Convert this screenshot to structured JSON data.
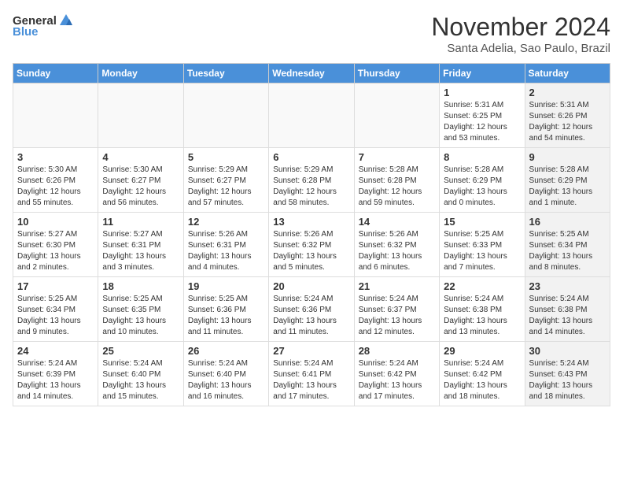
{
  "logo": {
    "general": "General",
    "blue": "Blue"
  },
  "header": {
    "month": "November 2024",
    "location": "Santa Adelia, Sao Paulo, Brazil"
  },
  "weekdays": [
    "Sunday",
    "Monday",
    "Tuesday",
    "Wednesday",
    "Thursday",
    "Friday",
    "Saturday"
  ],
  "weeks": [
    [
      {
        "day": "",
        "info": "",
        "empty": true
      },
      {
        "day": "",
        "info": "",
        "empty": true
      },
      {
        "day": "",
        "info": "",
        "empty": true
      },
      {
        "day": "",
        "info": "",
        "empty": true
      },
      {
        "day": "",
        "info": "",
        "empty": true
      },
      {
        "day": "1",
        "info": "Sunrise: 5:31 AM\nSunset: 6:25 PM\nDaylight: 12 hours\nand 53 minutes.",
        "empty": false,
        "shaded": false
      },
      {
        "day": "2",
        "info": "Sunrise: 5:31 AM\nSunset: 6:26 PM\nDaylight: 12 hours\nand 54 minutes.",
        "empty": false,
        "shaded": true
      }
    ],
    [
      {
        "day": "3",
        "info": "Sunrise: 5:30 AM\nSunset: 6:26 PM\nDaylight: 12 hours\nand 55 minutes.",
        "empty": false,
        "shaded": false
      },
      {
        "day": "4",
        "info": "Sunrise: 5:30 AM\nSunset: 6:27 PM\nDaylight: 12 hours\nand 56 minutes.",
        "empty": false,
        "shaded": false
      },
      {
        "day": "5",
        "info": "Sunrise: 5:29 AM\nSunset: 6:27 PM\nDaylight: 12 hours\nand 57 minutes.",
        "empty": false,
        "shaded": false
      },
      {
        "day": "6",
        "info": "Sunrise: 5:29 AM\nSunset: 6:28 PM\nDaylight: 12 hours\nand 58 minutes.",
        "empty": false,
        "shaded": false
      },
      {
        "day": "7",
        "info": "Sunrise: 5:28 AM\nSunset: 6:28 PM\nDaylight: 12 hours\nand 59 minutes.",
        "empty": false,
        "shaded": false
      },
      {
        "day": "8",
        "info": "Sunrise: 5:28 AM\nSunset: 6:29 PM\nDaylight: 13 hours\nand 0 minutes.",
        "empty": false,
        "shaded": false
      },
      {
        "day": "9",
        "info": "Sunrise: 5:28 AM\nSunset: 6:29 PM\nDaylight: 13 hours\nand 1 minute.",
        "empty": false,
        "shaded": true
      }
    ],
    [
      {
        "day": "10",
        "info": "Sunrise: 5:27 AM\nSunset: 6:30 PM\nDaylight: 13 hours\nand 2 minutes.",
        "empty": false,
        "shaded": false
      },
      {
        "day": "11",
        "info": "Sunrise: 5:27 AM\nSunset: 6:31 PM\nDaylight: 13 hours\nand 3 minutes.",
        "empty": false,
        "shaded": false
      },
      {
        "day": "12",
        "info": "Sunrise: 5:26 AM\nSunset: 6:31 PM\nDaylight: 13 hours\nand 4 minutes.",
        "empty": false,
        "shaded": false
      },
      {
        "day": "13",
        "info": "Sunrise: 5:26 AM\nSunset: 6:32 PM\nDaylight: 13 hours\nand 5 minutes.",
        "empty": false,
        "shaded": false
      },
      {
        "day": "14",
        "info": "Sunrise: 5:26 AM\nSunset: 6:32 PM\nDaylight: 13 hours\nand 6 minutes.",
        "empty": false,
        "shaded": false
      },
      {
        "day": "15",
        "info": "Sunrise: 5:25 AM\nSunset: 6:33 PM\nDaylight: 13 hours\nand 7 minutes.",
        "empty": false,
        "shaded": false
      },
      {
        "day": "16",
        "info": "Sunrise: 5:25 AM\nSunset: 6:34 PM\nDaylight: 13 hours\nand 8 minutes.",
        "empty": false,
        "shaded": true
      }
    ],
    [
      {
        "day": "17",
        "info": "Sunrise: 5:25 AM\nSunset: 6:34 PM\nDaylight: 13 hours\nand 9 minutes.",
        "empty": false,
        "shaded": false
      },
      {
        "day": "18",
        "info": "Sunrise: 5:25 AM\nSunset: 6:35 PM\nDaylight: 13 hours\nand 10 minutes.",
        "empty": false,
        "shaded": false
      },
      {
        "day": "19",
        "info": "Sunrise: 5:25 AM\nSunset: 6:36 PM\nDaylight: 13 hours\nand 11 minutes.",
        "empty": false,
        "shaded": false
      },
      {
        "day": "20",
        "info": "Sunrise: 5:24 AM\nSunset: 6:36 PM\nDaylight: 13 hours\nand 11 minutes.",
        "empty": false,
        "shaded": false
      },
      {
        "day": "21",
        "info": "Sunrise: 5:24 AM\nSunset: 6:37 PM\nDaylight: 13 hours\nand 12 minutes.",
        "empty": false,
        "shaded": false
      },
      {
        "day": "22",
        "info": "Sunrise: 5:24 AM\nSunset: 6:38 PM\nDaylight: 13 hours\nand 13 minutes.",
        "empty": false,
        "shaded": false
      },
      {
        "day": "23",
        "info": "Sunrise: 5:24 AM\nSunset: 6:38 PM\nDaylight: 13 hours\nand 14 minutes.",
        "empty": false,
        "shaded": true
      }
    ],
    [
      {
        "day": "24",
        "info": "Sunrise: 5:24 AM\nSunset: 6:39 PM\nDaylight: 13 hours\nand 14 minutes.",
        "empty": false,
        "shaded": false
      },
      {
        "day": "25",
        "info": "Sunrise: 5:24 AM\nSunset: 6:40 PM\nDaylight: 13 hours\nand 15 minutes.",
        "empty": false,
        "shaded": false
      },
      {
        "day": "26",
        "info": "Sunrise: 5:24 AM\nSunset: 6:40 PM\nDaylight: 13 hours\nand 16 minutes.",
        "empty": false,
        "shaded": false
      },
      {
        "day": "27",
        "info": "Sunrise: 5:24 AM\nSunset: 6:41 PM\nDaylight: 13 hours\nand 17 minutes.",
        "empty": false,
        "shaded": false
      },
      {
        "day": "28",
        "info": "Sunrise: 5:24 AM\nSunset: 6:42 PM\nDaylight: 13 hours\nand 17 minutes.",
        "empty": false,
        "shaded": false
      },
      {
        "day": "29",
        "info": "Sunrise: 5:24 AM\nSunset: 6:42 PM\nDaylight: 13 hours\nand 18 minutes.",
        "empty": false,
        "shaded": false
      },
      {
        "day": "30",
        "info": "Sunrise: 5:24 AM\nSunset: 6:43 PM\nDaylight: 13 hours\nand 18 minutes.",
        "empty": false,
        "shaded": true
      }
    ]
  ]
}
